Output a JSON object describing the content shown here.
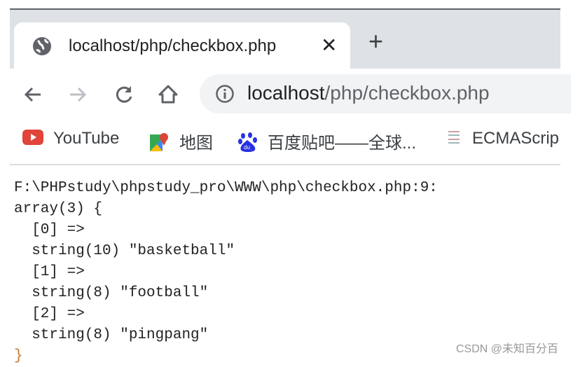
{
  "tab": {
    "title": "localhost/php/checkbox.php",
    "close_icon": "close-icon",
    "new_tab_icon": "plus-icon"
  },
  "toolbar": {
    "back_icon": "arrow-left-icon",
    "forward_icon": "arrow-right-icon",
    "reload_icon": "reload-icon",
    "home_icon": "home-icon"
  },
  "address": {
    "host": "localhost",
    "path": "/php/checkbox.php"
  },
  "bookmarks": [
    {
      "label": "YouTube",
      "icon": "youtube-icon"
    },
    {
      "label": "地图",
      "icon": "maps-icon"
    },
    {
      "label": "百度贴吧——全球...",
      "icon": "baidu-icon"
    },
    {
      "label": "ECMAScrip",
      "icon": "book-icon"
    }
  ],
  "output": {
    "lines": [
      "F:\\PHPstudy\\phpstudy_pro\\WWW\\php\\checkbox.php:9:",
      "array(3) {",
      "  [0] =>",
      "  string(10) \"basketball\"",
      "  [1] =>",
      "  string(8) \"football\"",
      "  [2] =>",
      "  string(8) \"pingpang\"",
      "}"
    ]
  },
  "watermark": "CSDN @未知百分百"
}
